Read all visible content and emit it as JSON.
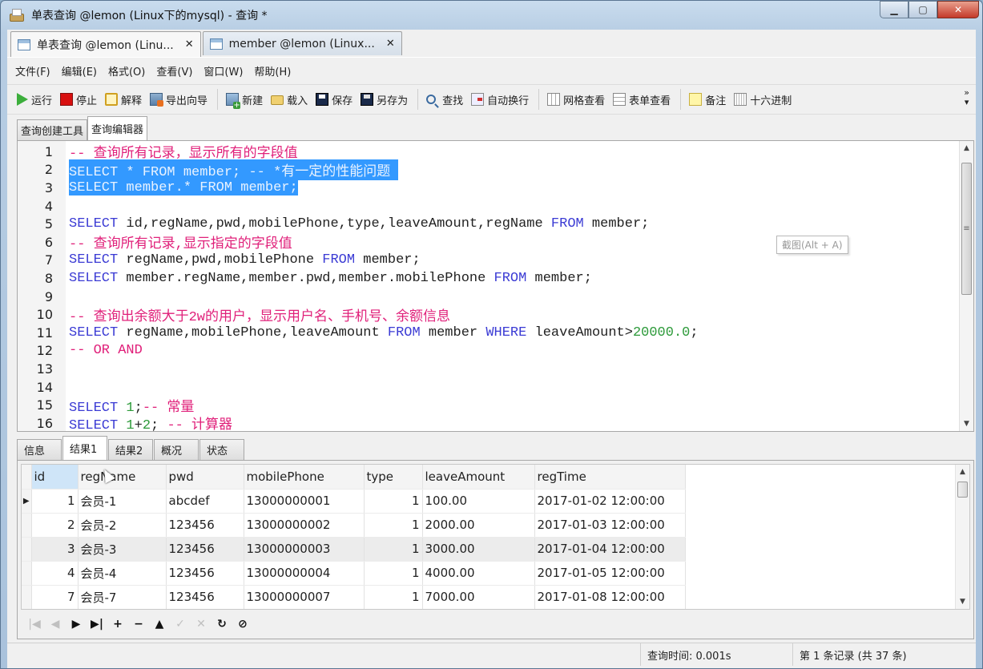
{
  "window": {
    "title": "单表查询 @lemon (Linux下的mysql) - 查询 *",
    "controls": [
      "minimize",
      "maximize",
      "close"
    ]
  },
  "doc_tabs": [
    {
      "label": "单表查询 @lemon (Linu...",
      "icon": "query-icon",
      "active": true
    },
    {
      "label": "member @lemon (Linux...",
      "icon": "table-icon",
      "active": false
    }
  ],
  "menu": [
    "文件(F)",
    "编辑(E)",
    "格式(O)",
    "查看(V)",
    "窗口(W)",
    "帮助(H)"
  ],
  "toolbar": {
    "run": "运行",
    "stop": "停止",
    "explain": "解释",
    "export_wizard": "导出向导",
    "new": "新建",
    "load": "载入",
    "save": "保存",
    "save_as": "另存为",
    "find": "查找",
    "word_wrap": "自动换行",
    "grid_view": "网格查看",
    "form_view": "表单查看",
    "memo": "备注",
    "hex": "十六进制",
    "more": "»"
  },
  "editor_tabs": [
    {
      "label": "查询创建工具",
      "active": false
    },
    {
      "label": "查询编辑器",
      "active": true
    }
  ],
  "editor": {
    "lines": [
      {
        "n": "1",
        "tokens": [
          [
            "cm",
            "-- 查询所有记录，显示所有的字段值"
          ]
        ]
      },
      {
        "n": "2",
        "sel": true,
        "tokens": [
          [
            "kw",
            "SELECT"
          ],
          [
            "",
            " * "
          ],
          [
            "kw",
            "FROM"
          ],
          [
            "",
            " member; "
          ],
          [
            "cm",
            "-- *有一定的性能问题 "
          ]
        ]
      },
      {
        "n": "3",
        "sel": true,
        "tokens": [
          [
            "kw",
            "SELECT"
          ],
          [
            "",
            " member.* "
          ],
          [
            "kw",
            "FROM"
          ],
          [
            "",
            " member;"
          ]
        ]
      },
      {
        "n": "4",
        "tokens": []
      },
      {
        "n": "5",
        "tokens": [
          [
            "kw",
            "SELECT"
          ],
          [
            "",
            " id,regName,pwd,mobilePhone,type,leaveAmount,regName "
          ],
          [
            "kw",
            "FROM"
          ],
          [
            "",
            " member;"
          ]
        ]
      },
      {
        "n": "6",
        "tokens": [
          [
            "cm",
            "-- 查询所有记录,显示指定的字段值"
          ]
        ]
      },
      {
        "n": "7",
        "tokens": [
          [
            "kw",
            "SELECT"
          ],
          [
            "",
            " regName,pwd,mobilePhone "
          ],
          [
            "kw",
            "FROM"
          ],
          [
            "",
            " member;"
          ]
        ]
      },
      {
        "n": "8",
        "tokens": [
          [
            "kw",
            "SELECT"
          ],
          [
            "",
            " member.regName,member.pwd,member.mobilePhone "
          ],
          [
            "kw",
            "FROM"
          ],
          [
            "",
            " member;"
          ]
        ]
      },
      {
        "n": "9",
        "tokens": []
      },
      {
        "n": "10",
        "tokens": [
          [
            "cm",
            "-- 查询出余额大于2w的用户，显示用户名、手机号、余额信息"
          ]
        ]
      },
      {
        "n": "11",
        "tokens": [
          [
            "kw",
            "SELECT"
          ],
          [
            "",
            " regName,mobilePhone,leaveAmount "
          ],
          [
            "kw",
            "FROM"
          ],
          [
            "",
            " member "
          ],
          [
            "kw",
            "WHERE"
          ],
          [
            "",
            " leaveAmount>"
          ],
          [
            "num",
            "20000.0"
          ],
          [
            "",
            ";"
          ]
        ]
      },
      {
        "n": "12",
        "tokens": [
          [
            "cm",
            "-- OR AND"
          ]
        ]
      },
      {
        "n": "13",
        "tokens": []
      },
      {
        "n": "14",
        "tokens": []
      },
      {
        "n": "15",
        "tokens": [
          [
            "kw",
            "SELECT"
          ],
          [
            "",
            " "
          ],
          [
            "num",
            "1"
          ],
          [
            "",
            ";"
          ],
          [
            "cm",
            "-- 常量"
          ]
        ]
      },
      {
        "n": "16",
        "tokens": [
          [
            "kw",
            "SELECT"
          ],
          [
            "",
            " "
          ],
          [
            "num",
            "1"
          ],
          [
            "",
            "+"
          ],
          [
            "num",
            "2"
          ],
          [
            "",
            "; "
          ],
          [
            "cm",
            "-- 计算器"
          ]
        ]
      }
    ],
    "tooltip": "截图(Alt + A)"
  },
  "result_tabs": [
    {
      "label": "信息",
      "active": false
    },
    {
      "label": "结果1",
      "active": true
    },
    {
      "label": "结果2",
      "active": false
    },
    {
      "label": "概况",
      "active": false
    },
    {
      "label": "状态",
      "active": false
    }
  ],
  "results": {
    "columns": [
      "id",
      "regName",
      "pwd",
      "mobilePhone",
      "type",
      "leaveAmount",
      "regTime"
    ],
    "rows": [
      {
        "current": true,
        "cells": [
          "1",
          "会员-1",
          "abcdef",
          "13000000001",
          "1",
          "100.00",
          "2017-01-02 12:00:00"
        ]
      },
      {
        "cells": [
          "2",
          "会员-2",
          "123456",
          "13000000002",
          "1",
          "2000.00",
          "2017-01-03 12:00:00"
        ]
      },
      {
        "highlight": true,
        "cells": [
          "3",
          "会员-3",
          "123456",
          "13000000003",
          "1",
          "3000.00",
          "2017-01-04 12:00:00"
        ]
      },
      {
        "cells": [
          "4",
          "会员-4",
          "123456",
          "13000000004",
          "1",
          "4000.00",
          "2017-01-05 12:00:00"
        ]
      },
      {
        "cells": [
          "7",
          "会员-7",
          "123456",
          "13000000007",
          "1",
          "7000.00",
          "2017-01-08 12:00:00"
        ]
      }
    ]
  },
  "nav_buttons": [
    {
      "name": "first-record",
      "glyph": "|◀",
      "enabled": false
    },
    {
      "name": "prev-record",
      "glyph": "◀",
      "enabled": false
    },
    {
      "name": "next-record",
      "glyph": "▶",
      "enabled": true
    },
    {
      "name": "last-record",
      "glyph": "▶|",
      "enabled": true
    },
    {
      "name": "add-record",
      "glyph": "+",
      "enabled": true
    },
    {
      "name": "delete-record",
      "glyph": "−",
      "enabled": true
    },
    {
      "name": "apply-changes",
      "glyph": "▲",
      "enabled": true
    },
    {
      "name": "confirm-changes",
      "glyph": "✓",
      "enabled": false
    },
    {
      "name": "cancel-changes",
      "glyph": "✕",
      "enabled": false
    },
    {
      "name": "refresh",
      "glyph": "↻",
      "enabled": true
    },
    {
      "name": "stop-loading",
      "glyph": "⊘",
      "enabled": true
    }
  ],
  "status": {
    "query_time": "查询时间: 0.001s",
    "record_info": "第 1 条记录 (共 37 条)"
  }
}
